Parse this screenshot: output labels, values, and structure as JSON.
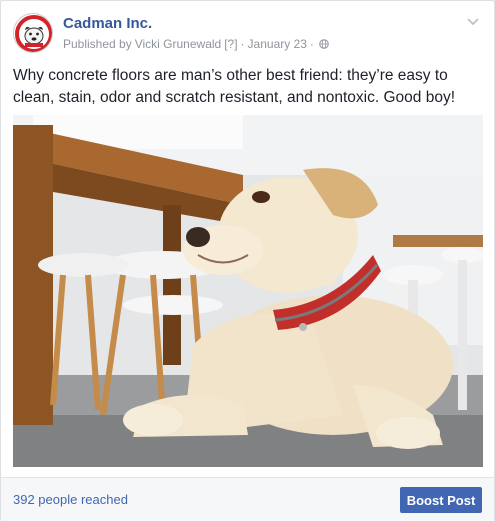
{
  "post": {
    "page_name": "Cadman Inc.",
    "published_prefix": "Published by",
    "author": "Vicki Grunewald",
    "help_marker": "[?]",
    "separator": "·",
    "date": "January 23",
    "privacy_icon": "globe-icon",
    "menu_icon": "chevron-down-icon",
    "text": "Why concrete floors are man’s other best friend: they’re easy to clean, stain, odor and scratch resistant, and nontoxic. Good boy!",
    "image_icon": "dog-photo"
  },
  "footer": {
    "reach": "392 people reached",
    "boost_label": "Boost Post"
  },
  "colors": {
    "brand_link": "#365899",
    "button": "#4267b2",
    "meta_text": "#90949c",
    "logo_red": "#d2232a"
  }
}
